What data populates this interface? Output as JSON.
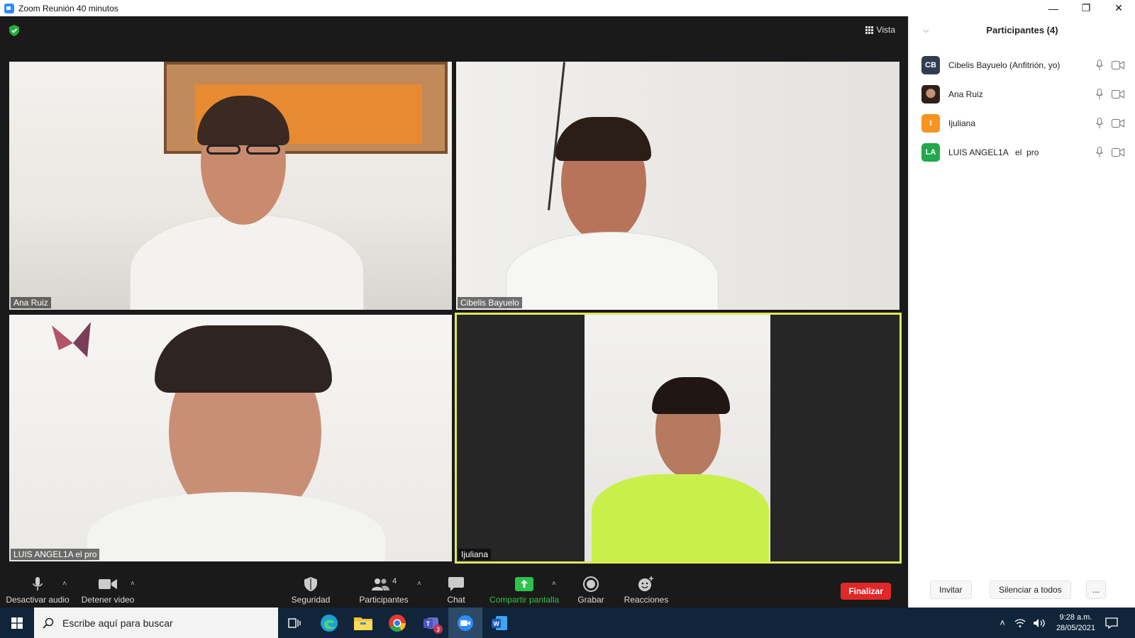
{
  "window": {
    "title": "Zoom Reunión 40 minutos",
    "controls": [
      "—",
      "❐",
      "✕"
    ]
  },
  "meeting": {
    "view_label": "Vista",
    "tiles": [
      {
        "name": "Ana Ruiz"
      },
      {
        "name": "Cibelis Bayuelo"
      },
      {
        "name": "LUIS ANGEL1A   el  pro"
      },
      {
        "name": "Ijuliana",
        "active_speaker": true
      }
    ],
    "accent_active": "#dbe95a"
  },
  "toolbar": {
    "mute_label": "Desactivar audio",
    "video_label": "Detener video",
    "security_label": "Seguridad",
    "participants_label": "Participantes",
    "participants_count": "4",
    "chat_label": "Chat",
    "share_label": "Compartir pantalla",
    "record_label": "Grabar",
    "reactions_label": "Reacciones",
    "end_label": "Finalizar",
    "end_color": "#e02828",
    "share_color": "#2ec24a"
  },
  "participants_panel": {
    "title": "Participantes (4)",
    "items": [
      {
        "initials": "CB",
        "name": "Cibelis Bayuelo (Anfitrión, yo)",
        "color": "#2f3d4f"
      },
      {
        "initials": "",
        "name": "Ana Ruiz",
        "color": "#6b4a3a"
      },
      {
        "initials": "I",
        "name": "Ijuliana",
        "color": "#f7931e"
      },
      {
        "initials": "LA",
        "name": "LUIS ANGEL1A   el  pro",
        "color": "#22a84a"
      }
    ],
    "invite_label": "Invitar",
    "mute_all_label": "Silenciar a todos",
    "more_label": "..."
  },
  "taskbar": {
    "search_placeholder": "Escribe aquí para buscar",
    "teams_badge": "3",
    "time": "9:28 a.m.",
    "date": "28/05/2021"
  }
}
